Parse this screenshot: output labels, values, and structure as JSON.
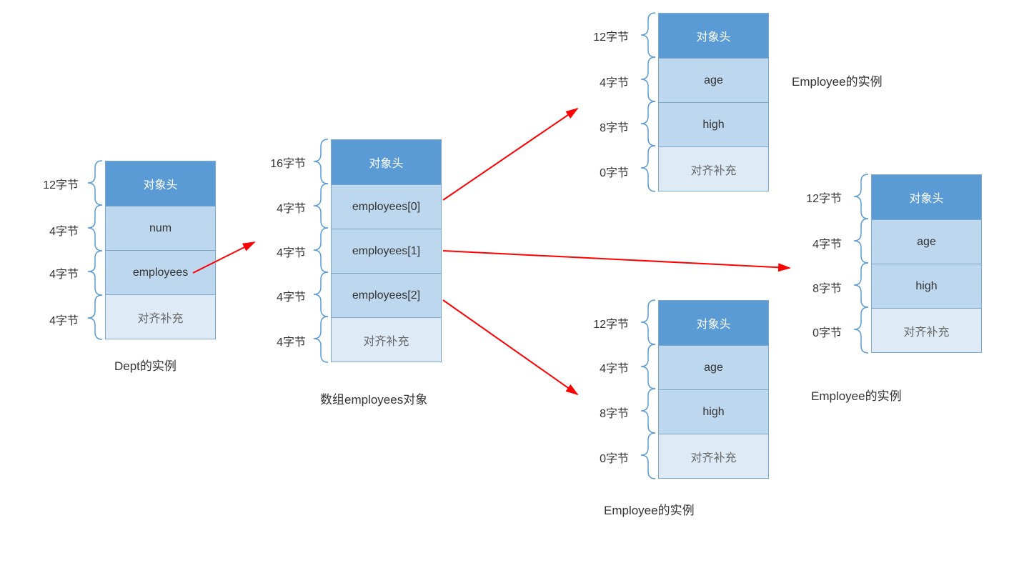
{
  "dept": {
    "caption": "Dept的实例",
    "rows": [
      {
        "size": "12字节",
        "label": "对象头",
        "kind": "header"
      },
      {
        "size": "4字节",
        "label": "num",
        "kind": "field"
      },
      {
        "size": "4字节",
        "label": "employees",
        "kind": "field"
      },
      {
        "size": "4字节",
        "label": "对齐补充",
        "kind": "pad"
      }
    ]
  },
  "array": {
    "caption": "数组employees对象",
    "rows": [
      {
        "size": "16字节",
        "label": "对象头",
        "kind": "header"
      },
      {
        "size": "4字节",
        "label": "employees[0]",
        "kind": "field"
      },
      {
        "size": "4字节",
        "label": "employees[1]",
        "kind": "field"
      },
      {
        "size": "4字节",
        "label": "employees[2]",
        "kind": "field"
      },
      {
        "size": "4字节",
        "label": "对齐补充",
        "kind": "pad"
      }
    ]
  },
  "emp": {
    "caption": "Employee的实例",
    "rows": [
      {
        "size": "12字节",
        "label": "对象头",
        "kind": "header"
      },
      {
        "size": "4字节",
        "label": "age",
        "kind": "field"
      },
      {
        "size": "8字节",
        "label": "high",
        "kind": "field"
      },
      {
        "size": "0字节",
        "label": "对齐补充",
        "kind": "pad"
      }
    ]
  }
}
